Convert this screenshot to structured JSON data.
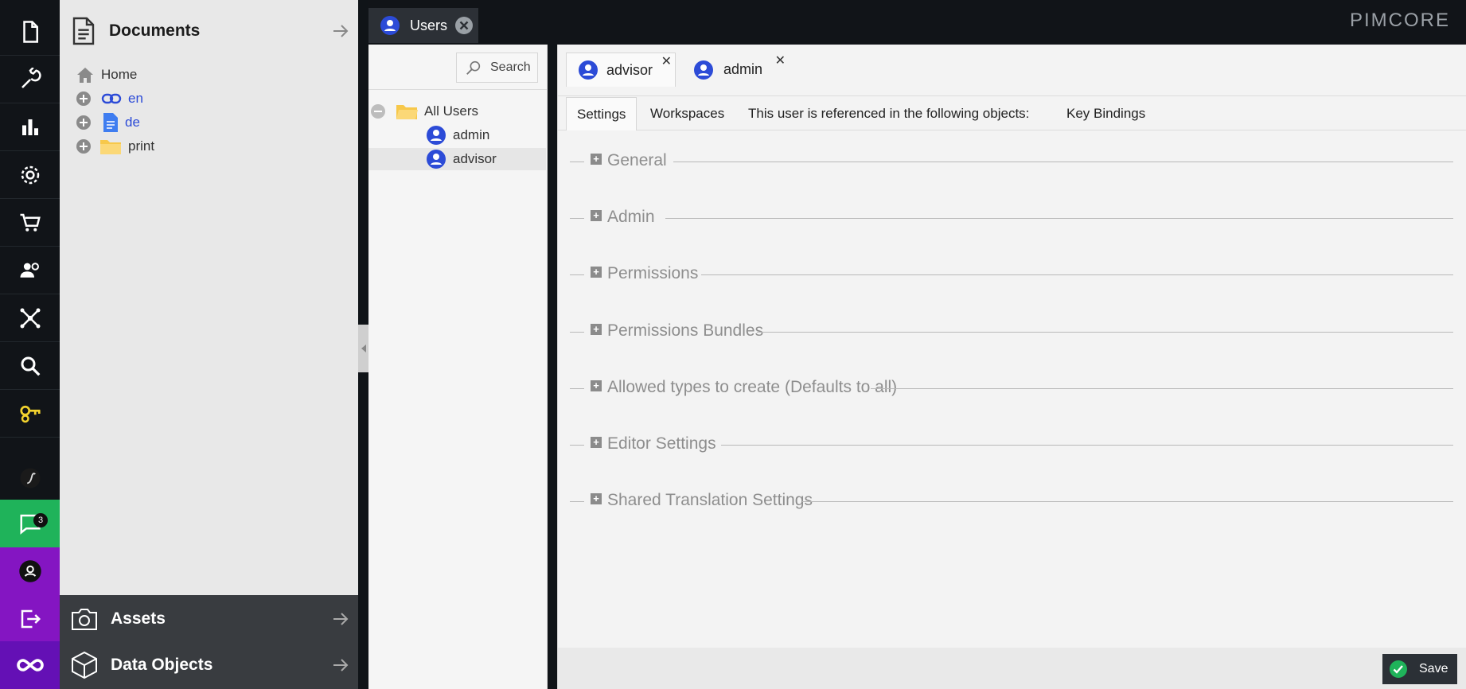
{
  "rail": {
    "notification_count": "3"
  },
  "left_panel": {
    "documents_title": "Documents",
    "tree": [
      {
        "label": "Home"
      },
      {
        "label": "en"
      },
      {
        "label": "de"
      },
      {
        "label": "print"
      }
    ],
    "assets_title": "Assets",
    "data_objects_title": "Data Objects"
  },
  "topbar": {
    "tab_label": "Users",
    "logo": "PIMCORE"
  },
  "user_tree": {
    "search_label": "Search",
    "root_label": "All Users",
    "users": [
      "admin",
      "advisor"
    ]
  },
  "editor": {
    "tabs": [
      "advisor",
      "admin"
    ],
    "subtabs": [
      "Settings",
      "Workspaces",
      "This user is referenced in the following objects:",
      "Key Bindings"
    ],
    "sections": [
      "General",
      "Admin",
      "Permissions",
      "Permissions Bundles",
      "Allowed types to create (Defaults to all)",
      "Editor Settings",
      "Shared Translation Settings"
    ],
    "save_label": "Save"
  },
  "colors": {
    "accent_green": "#1fb35a",
    "accent_purple": "#8415c2",
    "user_icon_blue": "#2c4bd7"
  }
}
